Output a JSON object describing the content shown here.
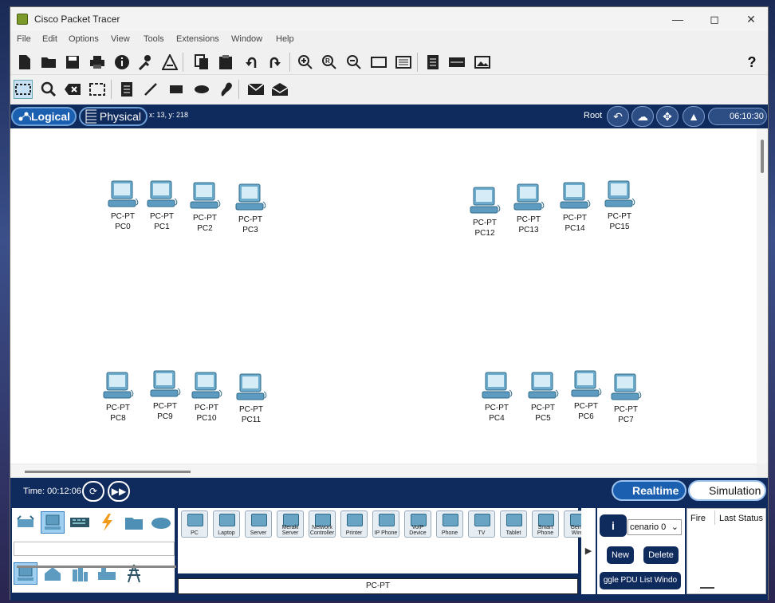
{
  "window": {
    "title": "Cisco Packet Tracer"
  },
  "menu": [
    "File",
    "Edit",
    "Options",
    "View",
    "Tools",
    "Extensions",
    "Window",
    "Help"
  ],
  "toolbar": {
    "help_label": "?"
  },
  "modebar": {
    "logical_label": "Logical",
    "physical_label": "Physical",
    "coords": "x: 13, y: 218",
    "root_label": "Root",
    "clock": "06:10:30"
  },
  "devices": [
    {
      "type": "PC-PT",
      "name": "PC0"
    },
    {
      "type": "PC-PT",
      "name": "PC1"
    },
    {
      "type": "PC-PT",
      "name": "PC2"
    },
    {
      "type": "PC-PT",
      "name": "PC3"
    },
    {
      "type": "PC-PT",
      "name": "PC12"
    },
    {
      "type": "PC-PT",
      "name": "PC13"
    },
    {
      "type": "PC-PT",
      "name": "PC14"
    },
    {
      "type": "PC-PT",
      "name": "PC15"
    },
    {
      "type": "PC-PT",
      "name": "PC8"
    },
    {
      "type": "PC-PT",
      "name": "PC9"
    },
    {
      "type": "PC-PT",
      "name": "PC10"
    },
    {
      "type": "PC-PT",
      "name": "PC11"
    },
    {
      "type": "PC-PT",
      "name": "PC4"
    },
    {
      "type": "PC-PT",
      "name": "PC5"
    },
    {
      "type": "PC-PT",
      "name": "PC6"
    },
    {
      "type": "PC-PT",
      "name": "PC7"
    }
  ],
  "bottombar": {
    "time": "Time: 00:12:06",
    "realtime_label": "Realtime",
    "simulation_label": "Simulation"
  },
  "device_types": [
    "PC",
    "Laptop",
    "Server",
    "Meraki Server",
    "Network Controller",
    "Printer",
    "IP Phone",
    "VoIP Device",
    "Phone",
    "TV",
    "Tablet",
    "Smart Phone",
    "Gene Wire"
  ],
  "selected_device_name": "PC-PT",
  "pdu": {
    "info_label": "i",
    "scenario": "cenario 0",
    "new_label": "New",
    "delete_label": "Delete",
    "toggle_label": "ggle PDU List Windo"
  },
  "events_table": {
    "col1": "Fire",
    "col2": "Last Status"
  }
}
